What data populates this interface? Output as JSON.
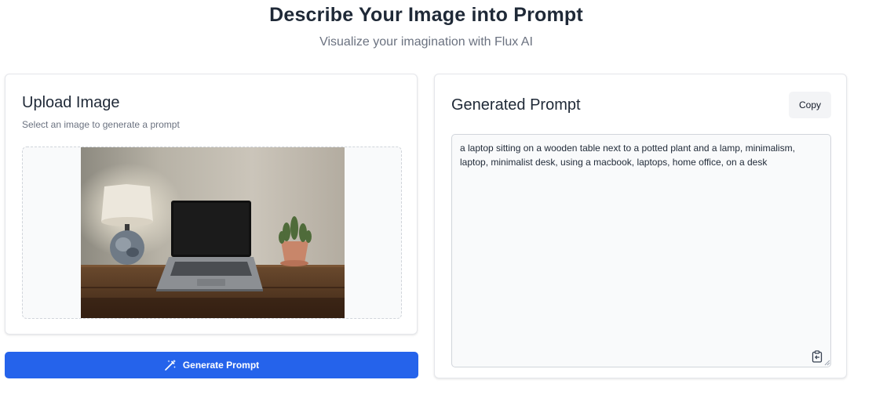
{
  "header": {
    "title": "Describe Your Image into Prompt",
    "subtitle": "Visualize your imagination with Flux AI"
  },
  "upload": {
    "title": "Upload Image",
    "description": "Select an image to generate a prompt",
    "icons": {
      "image": "uploaded-photo"
    }
  },
  "actions": {
    "generate_label": "Generate Prompt",
    "generate_icon": "magic-wand-icon",
    "copy_label": "Copy"
  },
  "prompt": {
    "title": "Generated Prompt",
    "text": "a laptop sitting on a wooden table next to a potted plant and a lamp, minimalism, laptop, minimalist desk, using a macbook, laptops, home office, on a desk",
    "icon": "clipboard-paste-icon"
  },
  "colors": {
    "accent": "#2563eb",
    "card_border": "#e5e7eb",
    "muted_text": "#6b7280"
  }
}
